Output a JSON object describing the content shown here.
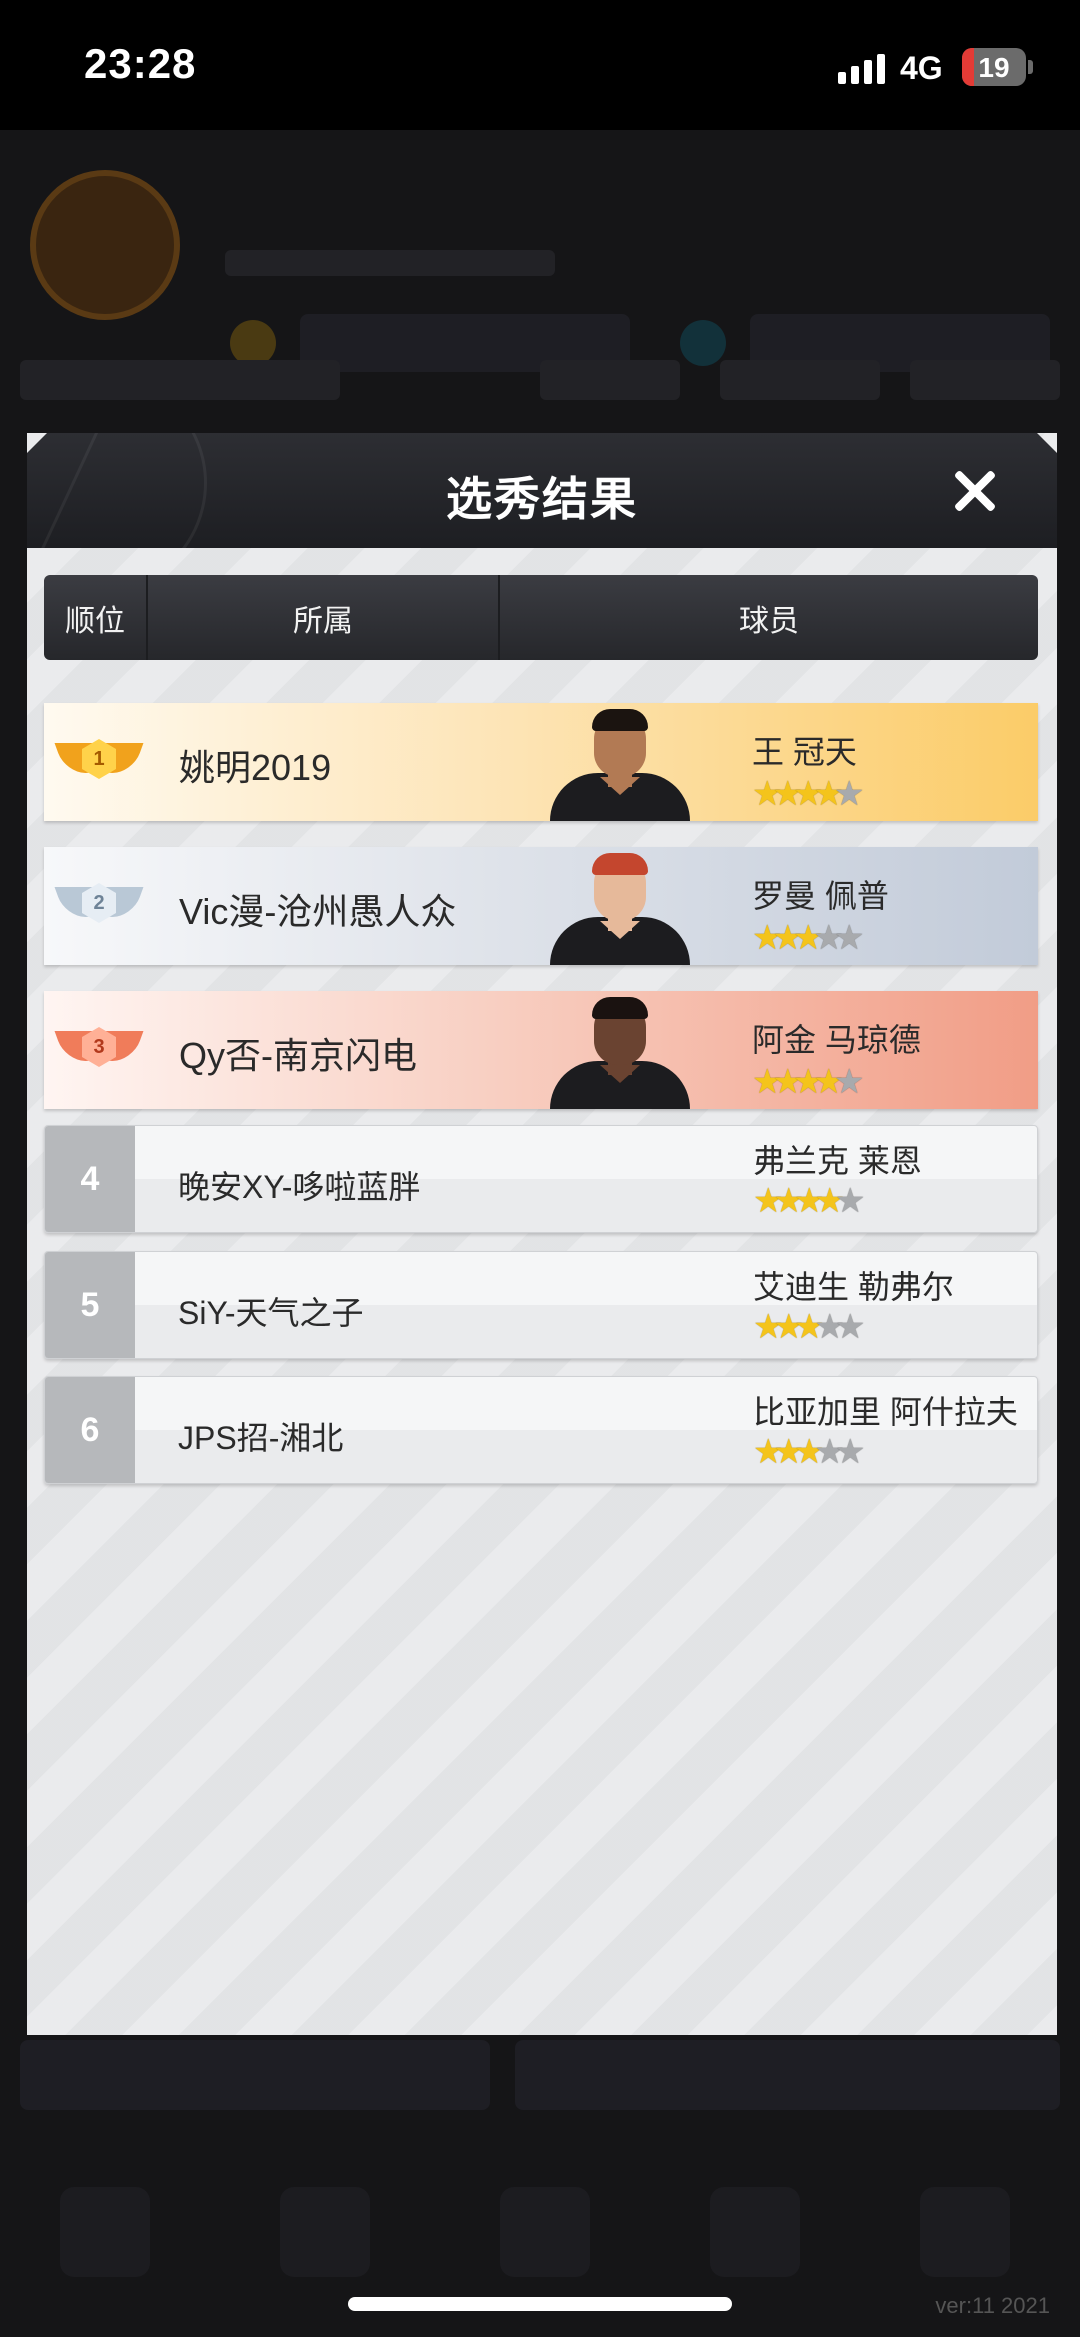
{
  "status_bar": {
    "time": "23:28",
    "network": "4G",
    "battery": "19",
    "battery_fraction": 0.19
  },
  "background": {
    "version": "ver:11 2021"
  },
  "dialog": {
    "title": "选秀结果",
    "columns": [
      "顺位",
      "所属",
      "球员"
    ],
    "picks": [
      {
        "rank": "1",
        "team": "姚明2019",
        "player": "王 冠天",
        "stars_on": 4,
        "stars_total": 5
      },
      {
        "rank": "2",
        "team": "Vic漫-沧州愚人众",
        "player": "罗曼 佩普",
        "stars_on": 3,
        "stars_total": 5
      },
      {
        "rank": "3",
        "team": "Qy否-南京闪电",
        "player": "阿金 马琼德",
        "stars_on": 4,
        "stars_total": 5
      },
      {
        "rank": "4",
        "team": "晚安XY-哆啦蓝胖",
        "player": "弗兰克 莱恩",
        "stars_on": 4,
        "stars_total": 5
      },
      {
        "rank": "5",
        "team": "SiY-天气之子",
        "player": "艾迪生 勒弗尔",
        "stars_on": 3,
        "stars_total": 5
      },
      {
        "rank": "6",
        "team": "JPS招-湘北",
        "player": "比亚加里 阿什拉夫",
        "stars_on": 3,
        "stars_total": 5
      }
    ]
  },
  "colors": {
    "gold_row": "#fbcc68",
    "silver_row": "#c2cbd9",
    "bronze_row": "#f19d86",
    "header": "#26272b"
  }
}
